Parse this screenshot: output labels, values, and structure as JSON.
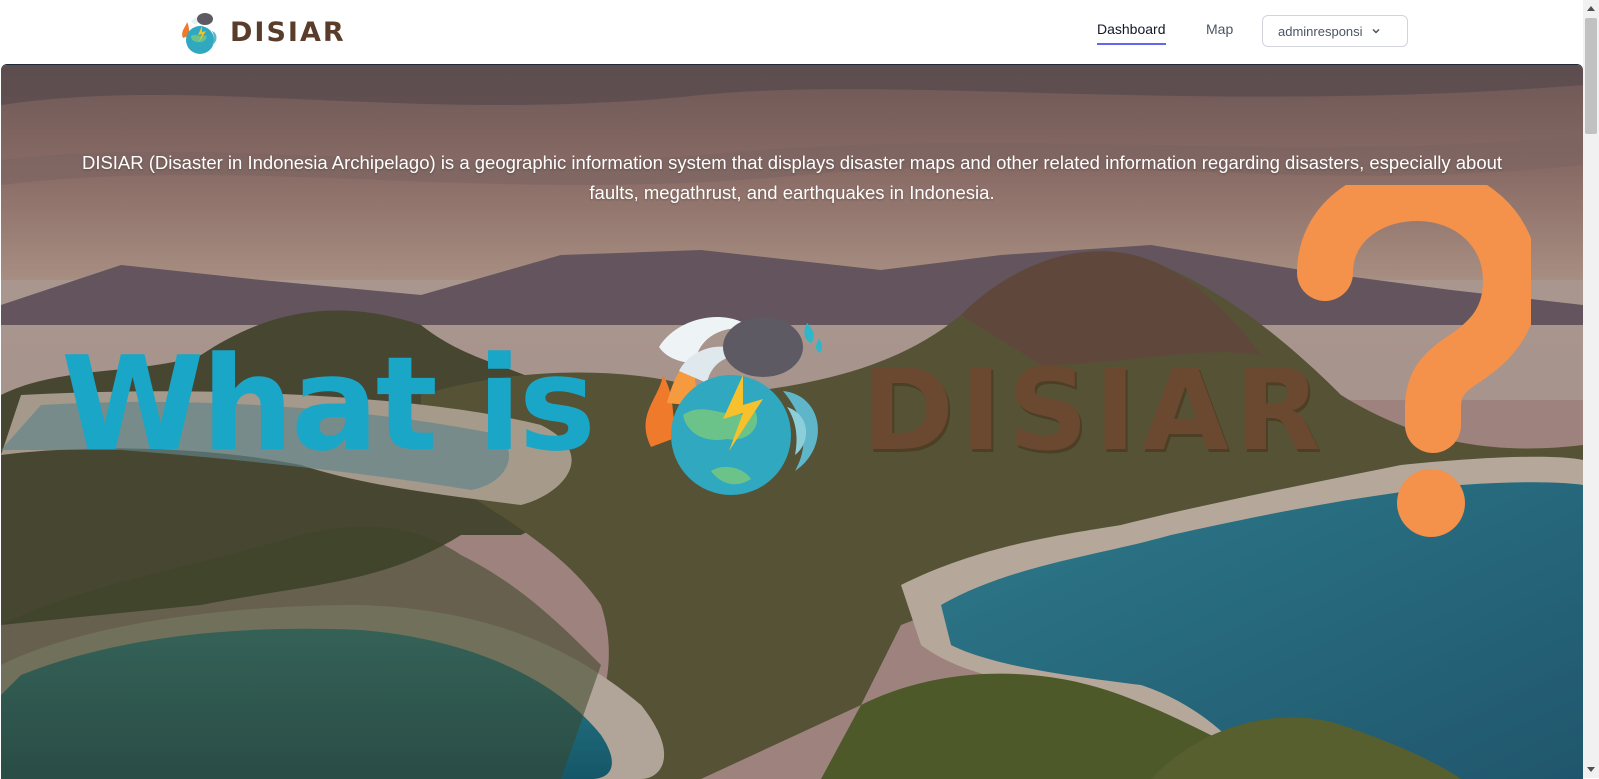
{
  "navbar": {
    "brand": {
      "name": "DISIAR",
      "logo_icon": "disaster-globe-logo"
    },
    "links": [
      {
        "label": "Dashboard",
        "active": true
      },
      {
        "label": "Map",
        "active": false
      }
    ],
    "user_menu": {
      "label": "adminresponsi",
      "icon": "chevron-down-icon"
    }
  },
  "hero": {
    "description": "DISIAR (Disaster in Indonesia Archipelago) is a geographic information system that displays disaster maps and other related information regarding disasters, especially about faults, megathrust, and earthquakes in Indonesia.",
    "headline": {
      "prefix": "What is",
      "brand": "DISIAR",
      "suffix_icon": "question-mark-icon"
    }
  },
  "colors": {
    "accent_underline": "#6366f1",
    "what_is_text": "#1aa6c7",
    "brand_brown": "#6b4830",
    "question_orange": "#f4914a"
  }
}
